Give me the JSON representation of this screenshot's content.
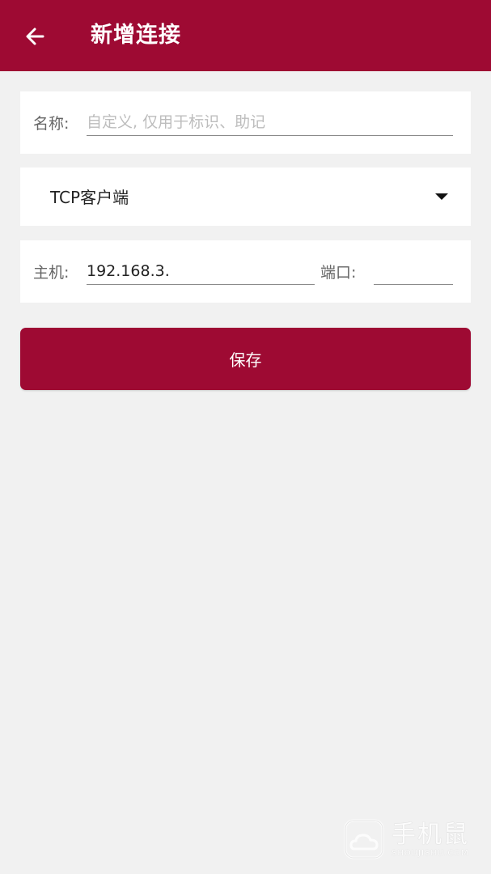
{
  "colors": {
    "brand": "#9e0a33",
    "background": "#f1f1f1"
  },
  "appbar": {
    "title": "新增连接",
    "back_icon": "arrow-left-icon"
  },
  "name_row": {
    "label": "名称:",
    "placeholder": "自定义, 仅用于标识、助记",
    "value": ""
  },
  "mode_row": {
    "selected": "TCP客户端",
    "dropdown_icon": "caret-down-icon"
  },
  "host_row": {
    "host_label": "主机:",
    "host_value": "192.168.3.",
    "port_label": "端口:",
    "port_value": ""
  },
  "save_button": {
    "label": "保存"
  },
  "watermark": {
    "main": "手机鼠",
    "sub": "SHOUJISHU.COM"
  }
}
